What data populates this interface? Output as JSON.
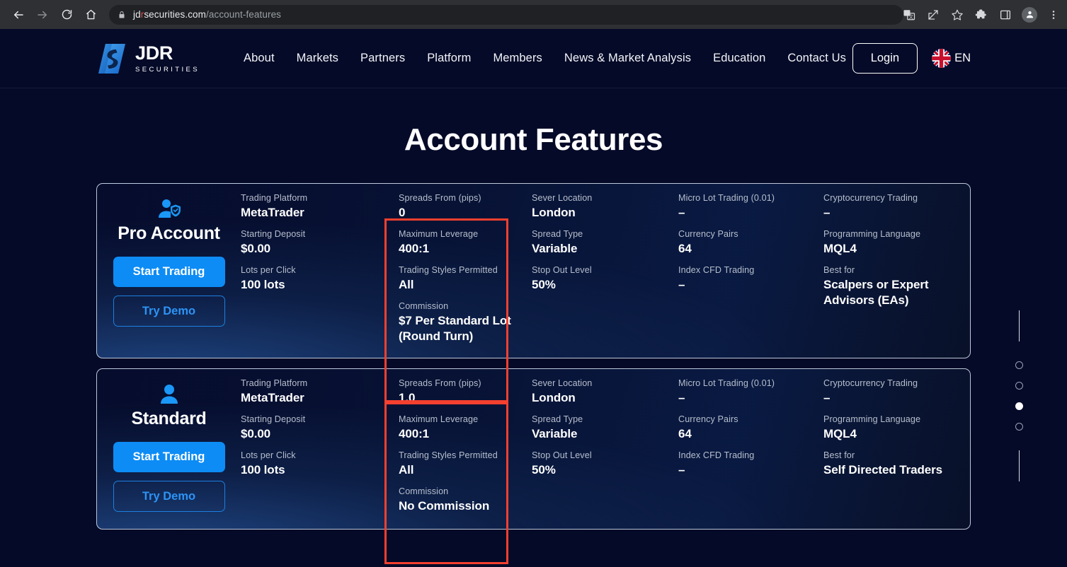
{
  "browser": {
    "back_icon": "back-arrow-icon",
    "forward_icon": "forward-arrow-icon",
    "reload_icon": "reload-icon",
    "home_icon": "home-icon",
    "lock_icon": "lock-icon",
    "url_domain_a": "jd",
    "url_domain_r": "r",
    "url_domain_b": "securities.com",
    "url_path": "/account-features",
    "translate_icon": "translate-icon",
    "share_icon": "share-icon",
    "bookmark_icon": "star-icon",
    "extensions_icon": "puzzle-extensions-icon",
    "sidepanel_icon": "side-panel-icon",
    "profile_icon": "profile-avatar-icon",
    "menu_icon": "three-dot-menu-icon"
  },
  "header": {
    "logo_name": "JDR",
    "logo_sub": "SECURITIES",
    "nav": [
      {
        "label": "About"
      },
      {
        "label": "Markets"
      },
      {
        "label": "Partners"
      },
      {
        "label": "Platform"
      },
      {
        "label": "Members"
      },
      {
        "label": "News & Market Analysis"
      },
      {
        "label": "Education"
      },
      {
        "label": "Contact Us"
      }
    ],
    "login_label": "Login",
    "lang_code": "EN",
    "flag_name": "uk-flag-icon"
  },
  "page": {
    "title": "Account Features"
  },
  "cards": [
    {
      "id": "pro",
      "icon": "user-shield-icon",
      "name": "Pro Account",
      "start_label": "Start Trading",
      "demo_label": "Try Demo",
      "col1": [
        {
          "label": "Trading Platform",
          "value": "MetaTrader"
        },
        {
          "label": "Starting Deposit",
          "value": "$0.00"
        },
        {
          "label": "Lots per Click",
          "value": "100 lots"
        }
      ],
      "col2": [
        {
          "label": "Spreads From (pips)",
          "value": "0"
        },
        {
          "label": "Maximum Leverage",
          "value": "400:1"
        },
        {
          "label": "Trading Styles Permitted",
          "value": "All"
        },
        {
          "label": "Commission",
          "value": "$7 Per Standard Lot (Round Turn)"
        }
      ],
      "col3": [
        {
          "label": "Sever Location",
          "value": "London"
        },
        {
          "label": "Spread Type",
          "value": "Variable"
        },
        {
          "label": "Stop Out Level",
          "value": "50%"
        }
      ],
      "col4": [
        {
          "label": "Micro Lot Trading (0.01)",
          "value": "–"
        },
        {
          "label": "Currency Pairs",
          "value": "64"
        },
        {
          "label": "Index CFD Trading",
          "value": "–"
        }
      ],
      "col5": [
        {
          "label": "Cryptocurrency Trading",
          "value": "–"
        },
        {
          "label": "Programming Language",
          "value": "MQL4"
        },
        {
          "label": "Best for",
          "value": "Scalpers or Expert Advisors (EAs)"
        }
      ]
    },
    {
      "id": "standard",
      "icon": "user-icon",
      "name": "Standard",
      "start_label": "Start Trading",
      "demo_label": "Try Demo",
      "col1": [
        {
          "label": "Trading Platform",
          "value": "MetaTrader"
        },
        {
          "label": "Starting Deposit",
          "value": "$0.00"
        },
        {
          "label": "Lots per Click",
          "value": "100 lots"
        }
      ],
      "col2": [
        {
          "label": "Spreads From (pips)",
          "value": "1.0"
        },
        {
          "label": "Maximum Leverage",
          "value": "400:1"
        },
        {
          "label": "Trading Styles Permitted",
          "value": "All"
        },
        {
          "label": "Commission",
          "value": "No Commission"
        }
      ],
      "col3": [
        {
          "label": "Sever Location",
          "value": "London"
        },
        {
          "label": "Spread Type",
          "value": "Variable"
        },
        {
          "label": "Stop Out Level",
          "value": "50%"
        }
      ],
      "col4": [
        {
          "label": "Micro Lot Trading (0.01)",
          "value": "–"
        },
        {
          "label": "Currency Pairs",
          "value": "64"
        },
        {
          "label": "Index CFD Trading",
          "value": "–"
        }
      ],
      "col5": [
        {
          "label": "Cryptocurrency Trading",
          "value": "–"
        },
        {
          "label": "Programming Language",
          "value": "MQL4"
        },
        {
          "label": "Best for",
          "value": "Self Directed Traders"
        }
      ]
    }
  ],
  "pagination": {
    "total": 4,
    "active_index": 2
  },
  "colors": {
    "page_bg": "#050a28",
    "accent_blue": "#0d8cf5",
    "demo_blue": "#2c94f5",
    "highlight_red": "#f4402f",
    "label_grey": "#b7bfcd",
    "white": "#ffffff"
  }
}
